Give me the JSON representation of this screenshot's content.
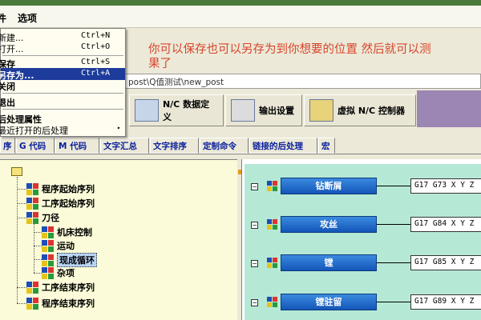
{
  "menubar": {
    "items": [
      {
        "label": "件"
      },
      {
        "label": "选项"
      }
    ]
  },
  "file_menu": {
    "items": [
      {
        "label": "新建...",
        "shortcut": "Ctrl+N"
      },
      {
        "label": "打开...",
        "shortcut": "Ctrl+O"
      },
      {
        "label": "保存",
        "shortcut": "Ctrl+S"
      },
      {
        "label": "另存为...",
        "shortcut": "Ctrl+A"
      },
      {
        "label": "关闭",
        "shortcut": ""
      },
      {
        "label": "退出",
        "shortcut": ""
      },
      {
        "label": "后处理属性",
        "shortcut": ""
      },
      {
        "label": "最近打开的后处理",
        "shortcut": "▸"
      }
    ]
  },
  "annotation": {
    "line1": "你可以保存也可以另存为到你想要的位置      然后就可以测",
    "line2": "果了"
  },
  "path_field": {
    "value": "post\\Q值测试\\new_post"
  },
  "toolbar": {
    "nc_data_def": "N/C 数据定义",
    "output_settings": "输出设置",
    "virtual_nc": "虚拟 N/C 控制器"
  },
  "tabs": [
    "序",
    "G 代码",
    "M 代码",
    "文字汇总",
    "文字排序",
    "定制命令",
    "链接的后处理",
    "宏"
  ],
  "tree": {
    "nodes": [
      {
        "label": "程序起始序列"
      },
      {
        "label": "工序起始序列"
      },
      {
        "label": "刀径"
      },
      {
        "label": "机床控制"
      },
      {
        "label": "运动"
      },
      {
        "label": "现成循环"
      },
      {
        "label": "杂项"
      },
      {
        "label": "工序结束序列"
      },
      {
        "label": "程序结束序列"
      }
    ]
  },
  "cycles": [
    {
      "label": "钻断屑",
      "code": "G17 G73 X Y Z"
    },
    {
      "label": "攻丝",
      "code": "G17 G84 X Y Z"
    },
    {
      "label": "镗",
      "code": "G17 G85 X Y Z"
    },
    {
      "label": "镗驻留",
      "code": "G17 G89 X Y Z"
    }
  ],
  "colors": {
    "annotation": "#d8452b",
    "menu_highlight": "#1c3b9a",
    "tree_bg": "#fbfbd9",
    "cycle_bg": "#b5e9d6",
    "cycle_button": "#1456b8",
    "purple_panel": "#9c86b4"
  }
}
